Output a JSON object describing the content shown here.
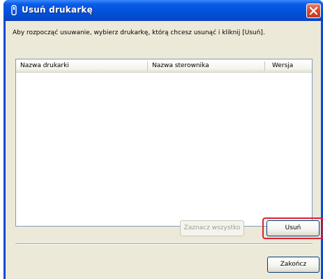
{
  "window": {
    "title": "Usuń drukarkę",
    "close_label": "Close"
  },
  "instruction": "Aby rozpocząć usuwanie, wybierz drukarkę, którą chcesz usunąć i kliknij [Usuń].",
  "list": {
    "columns": [
      "Nazwa drukarki",
      "Nazwa sterownika",
      "Wersja"
    ],
    "rows": []
  },
  "buttons": {
    "select_all": "Zaznacz wszystko",
    "remove": "Usuń",
    "finish": "Zakończ"
  },
  "colors": {
    "titlebar": "#0350d8",
    "dialog_background": "#ece9d8",
    "highlight_outline": "#e2202a"
  }
}
